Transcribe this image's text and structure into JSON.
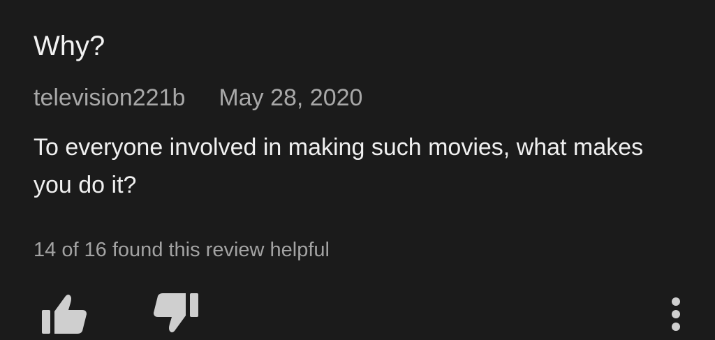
{
  "review": {
    "title": "Why?",
    "author": "television221b",
    "date": "May 28, 2020",
    "body": "To everyone involved in making such movies, what makes you do it?",
    "helpful_text": "14 of 16 found this review helpful"
  },
  "actions": {
    "thumbs_up_icon": "thumbs-up-icon",
    "thumbs_down_icon": "thumbs-down-icon",
    "more_icon": "more-vert-icon"
  },
  "colors": {
    "background": "#1b1b1b",
    "primary_text": "#f2f2f2",
    "secondary_text": "#a8a8a8",
    "icon": "#cfcfcf"
  }
}
